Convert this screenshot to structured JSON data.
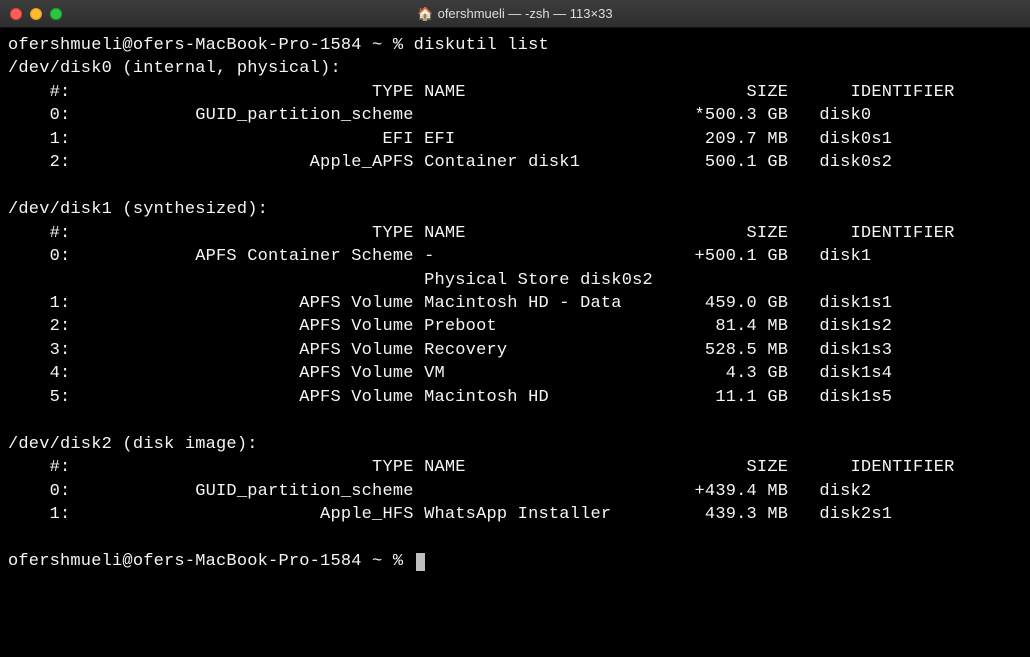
{
  "titlebar": {
    "icon": "🏠",
    "title": "ofershmueli — -zsh — 113×33"
  },
  "prompt": "ofershmueli@ofers-MacBook-Pro-1584 ~ % ",
  "command": "diskutil list",
  "header_cols": {
    "idx": "#:",
    "type": "TYPE",
    "name": "NAME",
    "size": "SIZE",
    "ident": "IDENTIFIER"
  },
  "disks": [
    {
      "header": "/dev/disk0 (internal, physical):",
      "rows": [
        {
          "idx": "0:",
          "type": "GUID_partition_scheme",
          "name": "",
          "size": "*500.3 GB",
          "ident": "disk0"
        },
        {
          "idx": "1:",
          "type": "EFI",
          "name": "EFI",
          "size": "209.7 MB",
          "ident": "disk0s1"
        },
        {
          "idx": "2:",
          "type": "Apple_APFS",
          "name": "Container disk1",
          "size": "500.1 GB",
          "ident": "disk0s2"
        }
      ]
    },
    {
      "header": "/dev/disk1 (synthesized):",
      "rows": [
        {
          "idx": "0:",
          "type": "APFS Container Scheme",
          "name": "-",
          "size": "+500.1 GB",
          "ident": "disk1",
          "sub": "Physical Store disk0s2"
        },
        {
          "idx": "1:",
          "type": "APFS Volume",
          "name": "Macintosh HD - Data",
          "size": "459.0 GB",
          "ident": "disk1s1"
        },
        {
          "idx": "2:",
          "type": "APFS Volume",
          "name": "Preboot",
          "size": "81.4 MB",
          "ident": "disk1s2"
        },
        {
          "idx": "3:",
          "type": "APFS Volume",
          "name": "Recovery",
          "size": "528.5 MB",
          "ident": "disk1s3"
        },
        {
          "idx": "4:",
          "type": "APFS Volume",
          "name": "VM",
          "size": "4.3 GB",
          "ident": "disk1s4"
        },
        {
          "idx": "5:",
          "type": "APFS Volume",
          "name": "Macintosh HD",
          "size": "11.1 GB",
          "ident": "disk1s5"
        }
      ]
    },
    {
      "header": "/dev/disk2 (disk image):",
      "rows": [
        {
          "idx": "0:",
          "type": "GUID_partition_scheme",
          "name": "",
          "size": "+439.4 MB",
          "ident": "disk2"
        },
        {
          "idx": "1:",
          "type": "Apple_HFS",
          "name": "WhatsApp Installer",
          "size": "439.3 MB",
          "ident": "disk2s1"
        }
      ]
    }
  ]
}
